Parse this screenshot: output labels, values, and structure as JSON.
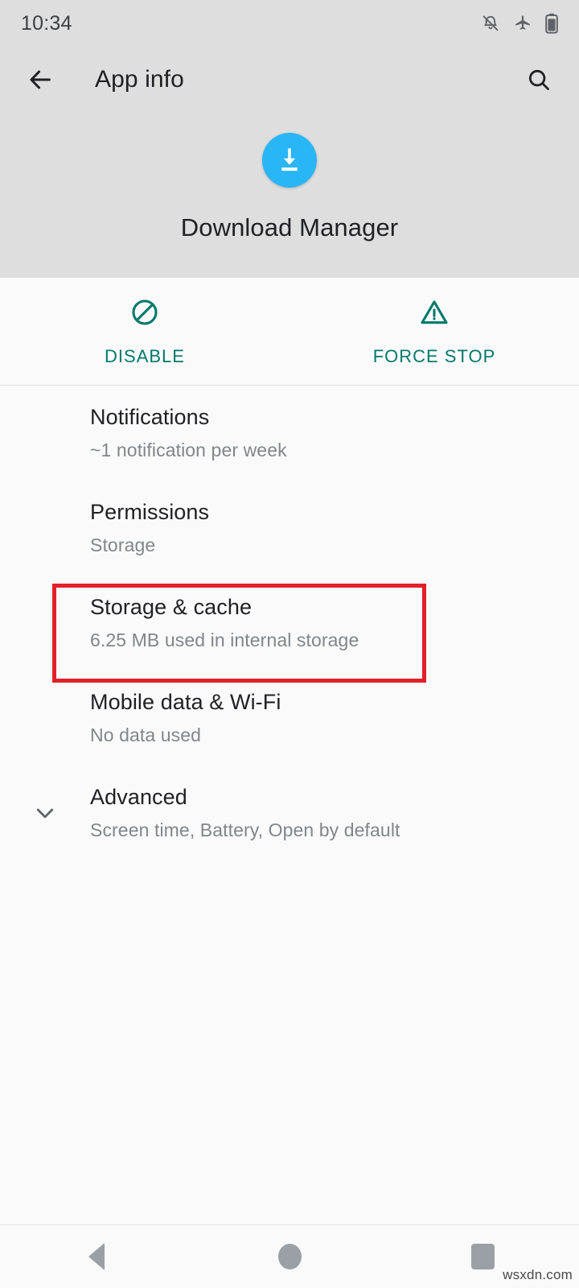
{
  "status_bar": {
    "clock": "10:34",
    "icons": [
      "notifications-off-icon",
      "airplane-mode-icon",
      "battery-icon"
    ]
  },
  "toolbar": {
    "back_icon": "back-arrow-icon",
    "title": "App info",
    "search_icon": "search-icon"
  },
  "app_header": {
    "icon": "download-manager-icon",
    "icon_color": "#29b6f6",
    "name": "Download Manager"
  },
  "actions": {
    "accent_color": "#00796b",
    "buttons": [
      {
        "label": "DISABLE",
        "icon": "block-icon"
      },
      {
        "label": "FORCE STOP",
        "icon": "warning-triangle-icon"
      }
    ]
  },
  "settings_rows": [
    {
      "title": "Notifications",
      "subtitle": "~1 notification per week",
      "chevron": false
    },
    {
      "title": "Permissions",
      "subtitle": "Storage",
      "chevron": false
    },
    {
      "title": "Storage & cache",
      "subtitle": "6.25 MB used in internal storage",
      "chevron": false
    },
    {
      "title": "Mobile data & Wi-Fi",
      "subtitle": "No data used",
      "chevron": false
    },
    {
      "title": "Advanced",
      "subtitle": "Screen time, Battery, Open by default",
      "chevron": true
    }
  ],
  "highlight": {
    "color": "#e12029",
    "target": "Storage & cache"
  },
  "nav_bar": {
    "back": "back-triangle-icon",
    "home": "home-circle-icon",
    "recents": "recents-square-icon"
  },
  "watermark": "wsxdn.com"
}
